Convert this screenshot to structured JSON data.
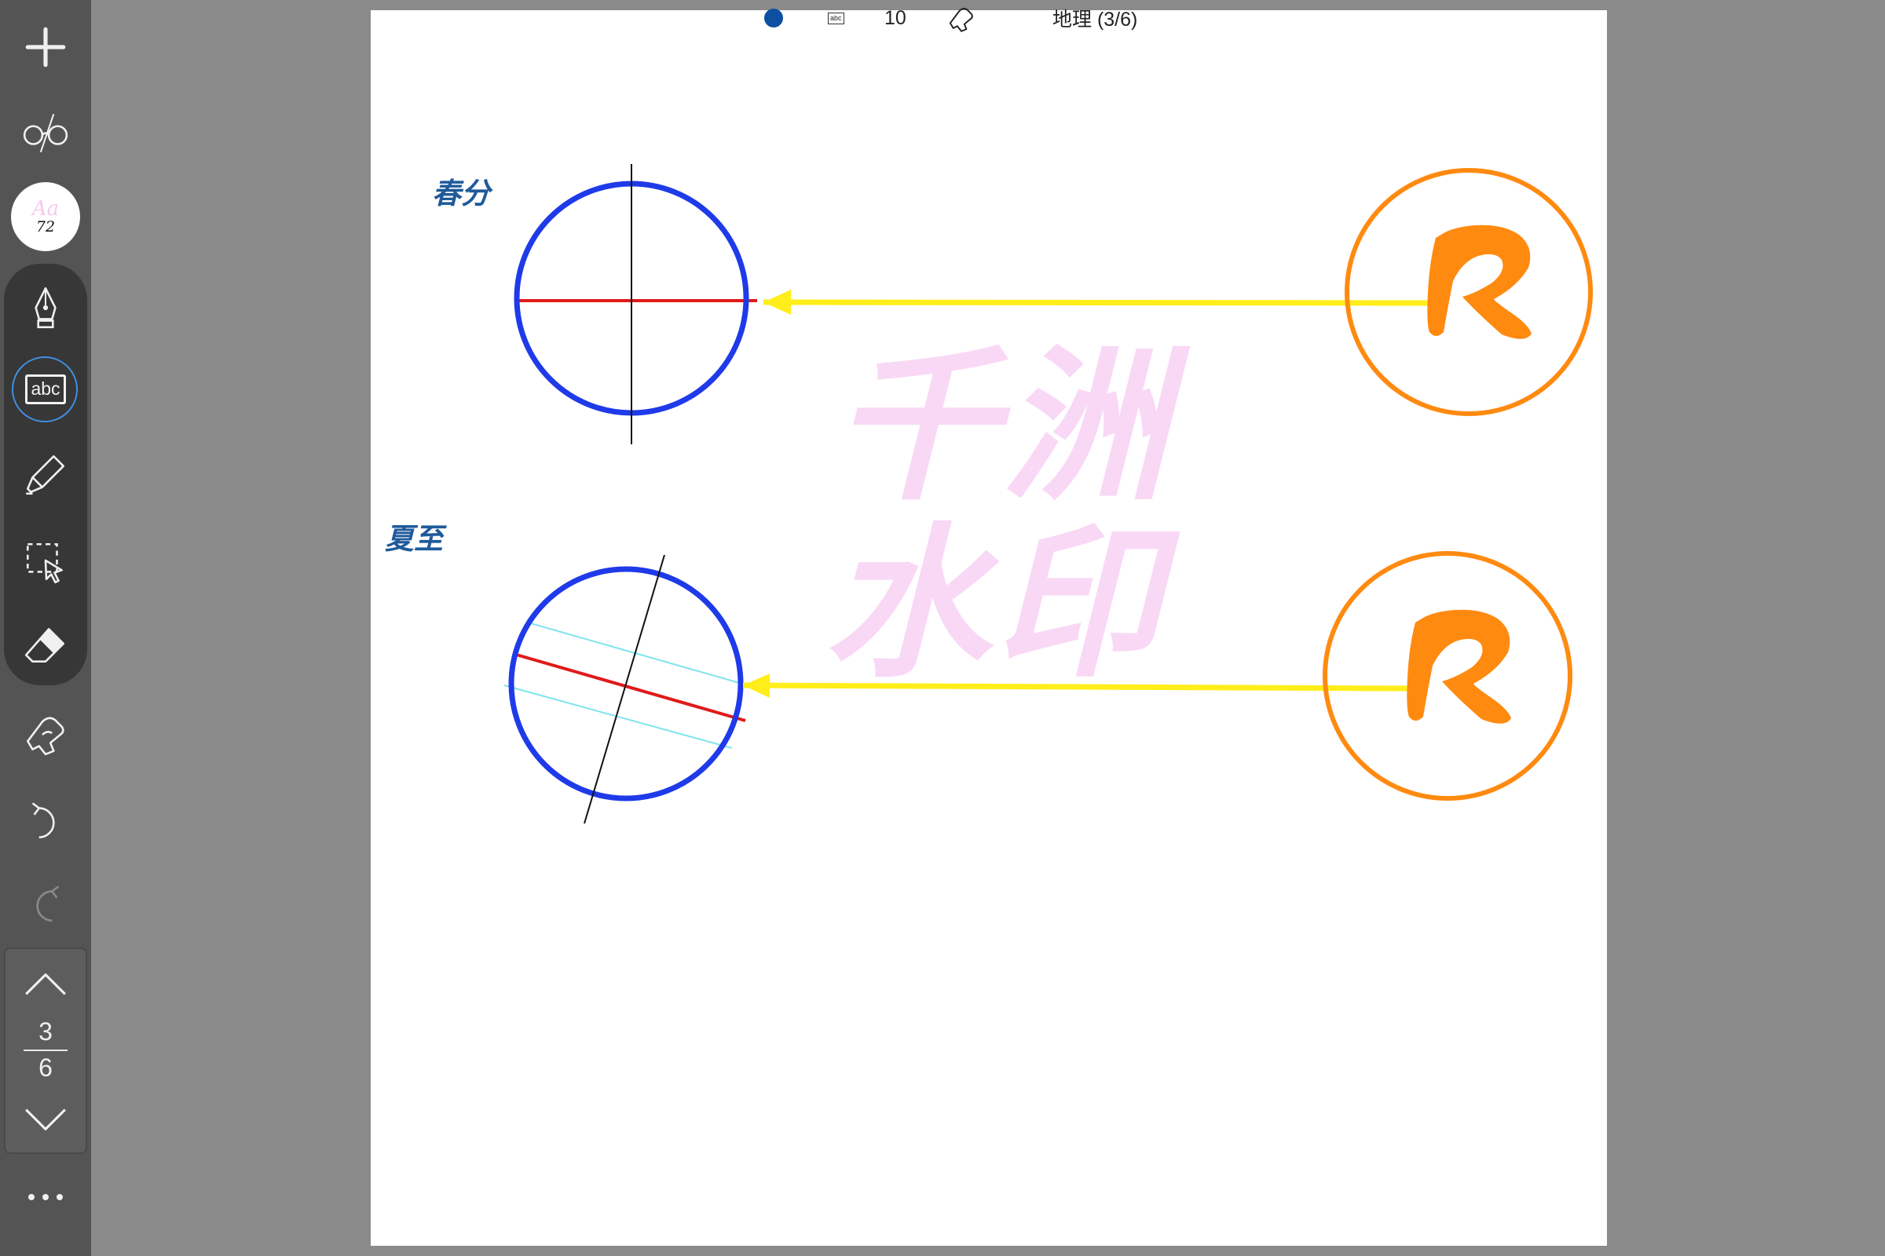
{
  "toolbar": {
    "add_icon": "plus-icon",
    "view_icon": "glasses-icon",
    "font_chip": {
      "sample": "Aa",
      "size": "72"
    },
    "tools": [
      "pen-tool-icon",
      "text-tool-icon",
      "highlighter-icon",
      "lasso-select-icon",
      "eraser-icon"
    ],
    "text_tool_label": "abc",
    "pointer_icon": "hand-pointer-icon",
    "undo_icon": "undo-icon",
    "redo_icon": "redo-icon",
    "more_icon": "more-dots-icon"
  },
  "page_nav": {
    "current": "3",
    "total": "6"
  },
  "status_bar": {
    "color_dot": "#0d4fa0",
    "mode_label": "abc",
    "size": "10",
    "notebook_title": "地理 (3/6)"
  },
  "canvas": {
    "labels": {
      "equinox": "春分",
      "solstice": "夏至"
    },
    "watermark": {
      "line1": "千洲",
      "line2": "水印"
    },
    "colors": {
      "earth": "#1f3ae8",
      "equator": "#e01a1a",
      "tropic": "#7fe3ee",
      "axis": "#111111",
      "sunlight": "#ffee1a",
      "sun": "#ff8a10"
    }
  }
}
